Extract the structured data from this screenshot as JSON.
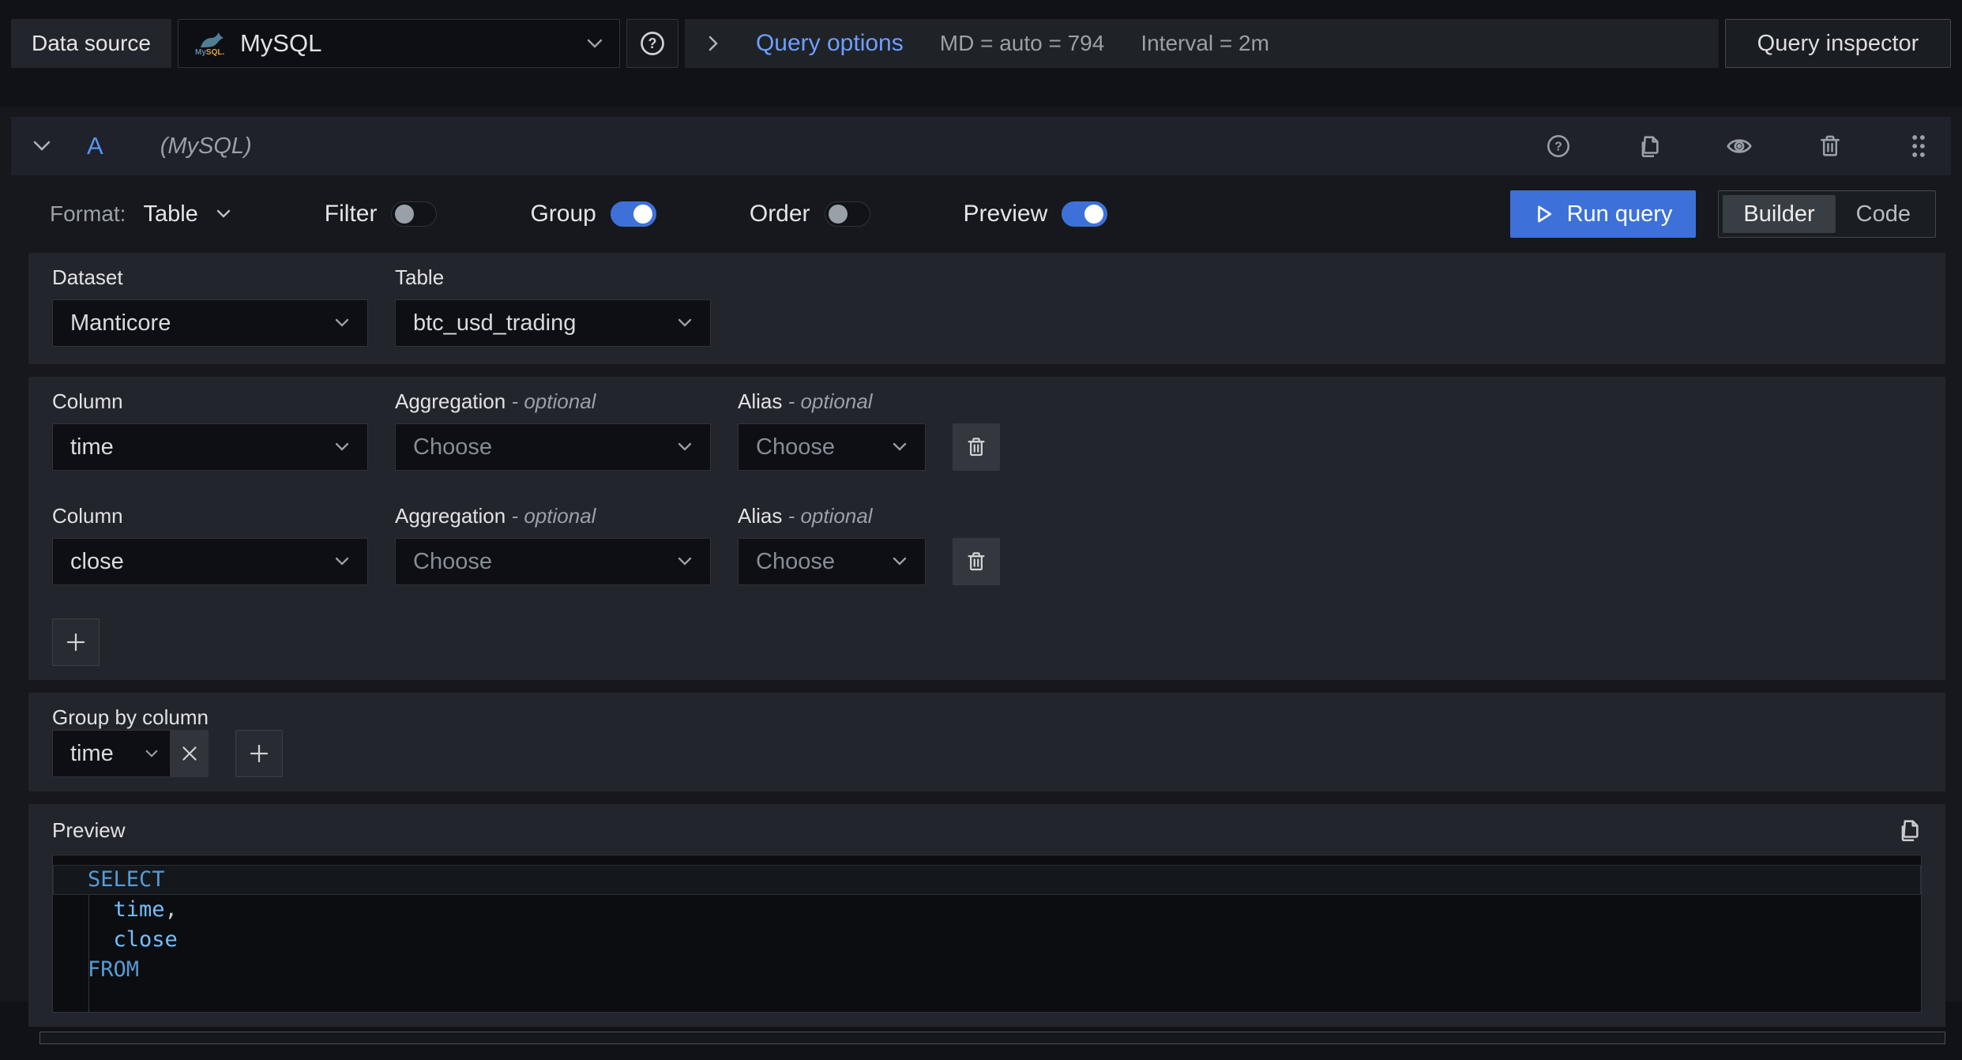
{
  "colors": {
    "accent_blue": "#3d71d9",
    "link_blue": "#6e9fff",
    "ref_id_blue": "#5794f2",
    "sql_keyword_blue": "#569cd6",
    "sql_identifier_blue": "#75beff",
    "card_background": "#22252b",
    "input_background": "#0d0f14"
  },
  "topbar": {
    "datasource_label": "Data source",
    "datasource_value": "MySQL",
    "query_options_label": "Query options",
    "max_data_points_text": "MD = auto = 794",
    "interval_text": "Interval = 2m",
    "query_inspector_label": "Query inspector"
  },
  "query_row": {
    "ref_id": "A",
    "datasource_hint": "(MySQL)"
  },
  "toolbar": {
    "format_label": "Format:",
    "format_value": "Table",
    "toggles": [
      {
        "label": "Filter",
        "on": false
      },
      {
        "label": "Group",
        "on": true
      },
      {
        "label": "Order",
        "on": false
      },
      {
        "label": "Preview",
        "on": true
      }
    ],
    "run_query_label": "Run query",
    "mode_options": [
      "Builder",
      "Code"
    ],
    "mode_selected": "Builder"
  },
  "dataset_section": {
    "dataset_label": "Dataset",
    "dataset_value": "Manticore",
    "table_label": "Table",
    "table_value": "btc_usd_trading"
  },
  "columns_section": {
    "rows": [
      {
        "column_label": "Column",
        "column_value": "time",
        "aggregation_label": "Aggregation",
        "aggregation_optional": "- optional",
        "aggregation_placeholder": "Choose",
        "alias_label": "Alias",
        "alias_optional": "- optional",
        "alias_placeholder": "Choose"
      },
      {
        "column_label": "Column",
        "column_value": "close",
        "aggregation_label": "Aggregation",
        "aggregation_optional": "- optional",
        "aggregation_placeholder": "Choose",
        "alias_label": "Alias",
        "alias_optional": "- optional",
        "alias_placeholder": "Choose"
      }
    ]
  },
  "group_by_section": {
    "label": "Group by column",
    "value": "time"
  },
  "preview": {
    "label": "Preview",
    "sql_lines": [
      {
        "keyword": "SELECT",
        "identifier": "",
        "punct": ""
      },
      {
        "keyword": "",
        "identifier": "  time",
        "punct": ","
      },
      {
        "keyword": "",
        "identifier": "  close",
        "punct": ""
      },
      {
        "keyword": "FROM",
        "identifier": "",
        "punct": ""
      }
    ]
  }
}
